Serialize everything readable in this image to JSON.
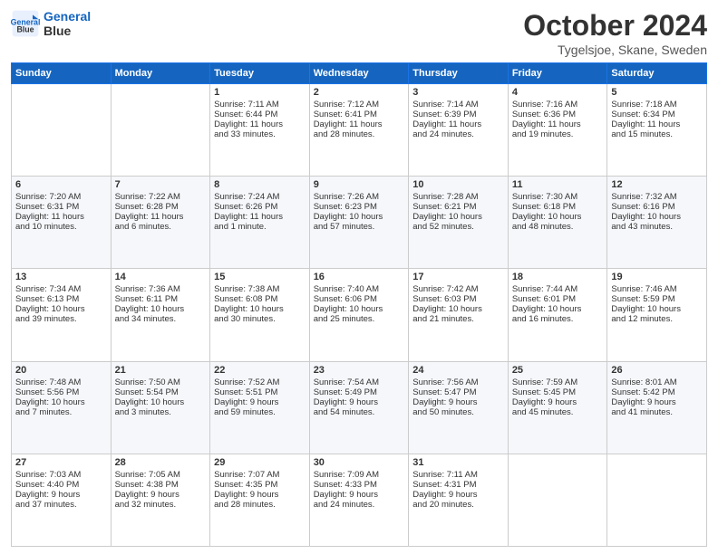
{
  "header": {
    "logo_line1": "General",
    "logo_line2": "Blue",
    "month_title": "October 2024",
    "location": "Tygelsjoe, Skane, Sweden"
  },
  "days_of_week": [
    "Sunday",
    "Monday",
    "Tuesday",
    "Wednesday",
    "Thursday",
    "Friday",
    "Saturday"
  ],
  "weeks": [
    [
      {
        "day": "",
        "text": ""
      },
      {
        "day": "",
        "text": ""
      },
      {
        "day": "1",
        "text": "Sunrise: 7:11 AM\nSunset: 6:44 PM\nDaylight: 11 hours\nand 33 minutes."
      },
      {
        "day": "2",
        "text": "Sunrise: 7:12 AM\nSunset: 6:41 PM\nDaylight: 11 hours\nand 28 minutes."
      },
      {
        "day": "3",
        "text": "Sunrise: 7:14 AM\nSunset: 6:39 PM\nDaylight: 11 hours\nand 24 minutes."
      },
      {
        "day": "4",
        "text": "Sunrise: 7:16 AM\nSunset: 6:36 PM\nDaylight: 11 hours\nand 19 minutes."
      },
      {
        "day": "5",
        "text": "Sunrise: 7:18 AM\nSunset: 6:34 PM\nDaylight: 11 hours\nand 15 minutes."
      }
    ],
    [
      {
        "day": "6",
        "text": "Sunrise: 7:20 AM\nSunset: 6:31 PM\nDaylight: 11 hours\nand 10 minutes."
      },
      {
        "day": "7",
        "text": "Sunrise: 7:22 AM\nSunset: 6:28 PM\nDaylight: 11 hours\nand 6 minutes."
      },
      {
        "day": "8",
        "text": "Sunrise: 7:24 AM\nSunset: 6:26 PM\nDaylight: 11 hours\nand 1 minute."
      },
      {
        "day": "9",
        "text": "Sunrise: 7:26 AM\nSunset: 6:23 PM\nDaylight: 10 hours\nand 57 minutes."
      },
      {
        "day": "10",
        "text": "Sunrise: 7:28 AM\nSunset: 6:21 PM\nDaylight: 10 hours\nand 52 minutes."
      },
      {
        "day": "11",
        "text": "Sunrise: 7:30 AM\nSunset: 6:18 PM\nDaylight: 10 hours\nand 48 minutes."
      },
      {
        "day": "12",
        "text": "Sunrise: 7:32 AM\nSunset: 6:16 PM\nDaylight: 10 hours\nand 43 minutes."
      }
    ],
    [
      {
        "day": "13",
        "text": "Sunrise: 7:34 AM\nSunset: 6:13 PM\nDaylight: 10 hours\nand 39 minutes."
      },
      {
        "day": "14",
        "text": "Sunrise: 7:36 AM\nSunset: 6:11 PM\nDaylight: 10 hours\nand 34 minutes."
      },
      {
        "day": "15",
        "text": "Sunrise: 7:38 AM\nSunset: 6:08 PM\nDaylight: 10 hours\nand 30 minutes."
      },
      {
        "day": "16",
        "text": "Sunrise: 7:40 AM\nSunset: 6:06 PM\nDaylight: 10 hours\nand 25 minutes."
      },
      {
        "day": "17",
        "text": "Sunrise: 7:42 AM\nSunset: 6:03 PM\nDaylight: 10 hours\nand 21 minutes."
      },
      {
        "day": "18",
        "text": "Sunrise: 7:44 AM\nSunset: 6:01 PM\nDaylight: 10 hours\nand 16 minutes."
      },
      {
        "day": "19",
        "text": "Sunrise: 7:46 AM\nSunset: 5:59 PM\nDaylight: 10 hours\nand 12 minutes."
      }
    ],
    [
      {
        "day": "20",
        "text": "Sunrise: 7:48 AM\nSunset: 5:56 PM\nDaylight: 10 hours\nand 7 minutes."
      },
      {
        "day": "21",
        "text": "Sunrise: 7:50 AM\nSunset: 5:54 PM\nDaylight: 10 hours\nand 3 minutes."
      },
      {
        "day": "22",
        "text": "Sunrise: 7:52 AM\nSunset: 5:51 PM\nDaylight: 9 hours\nand 59 minutes."
      },
      {
        "day": "23",
        "text": "Sunrise: 7:54 AM\nSunset: 5:49 PM\nDaylight: 9 hours\nand 54 minutes."
      },
      {
        "day": "24",
        "text": "Sunrise: 7:56 AM\nSunset: 5:47 PM\nDaylight: 9 hours\nand 50 minutes."
      },
      {
        "day": "25",
        "text": "Sunrise: 7:59 AM\nSunset: 5:45 PM\nDaylight: 9 hours\nand 45 minutes."
      },
      {
        "day": "26",
        "text": "Sunrise: 8:01 AM\nSunset: 5:42 PM\nDaylight: 9 hours\nand 41 minutes."
      }
    ],
    [
      {
        "day": "27",
        "text": "Sunrise: 7:03 AM\nSunset: 4:40 PM\nDaylight: 9 hours\nand 37 minutes."
      },
      {
        "day": "28",
        "text": "Sunrise: 7:05 AM\nSunset: 4:38 PM\nDaylight: 9 hours\nand 32 minutes."
      },
      {
        "day": "29",
        "text": "Sunrise: 7:07 AM\nSunset: 4:35 PM\nDaylight: 9 hours\nand 28 minutes."
      },
      {
        "day": "30",
        "text": "Sunrise: 7:09 AM\nSunset: 4:33 PM\nDaylight: 9 hours\nand 24 minutes."
      },
      {
        "day": "31",
        "text": "Sunrise: 7:11 AM\nSunset: 4:31 PM\nDaylight: 9 hours\nand 20 minutes."
      },
      {
        "day": "",
        "text": ""
      },
      {
        "day": "",
        "text": ""
      }
    ]
  ]
}
